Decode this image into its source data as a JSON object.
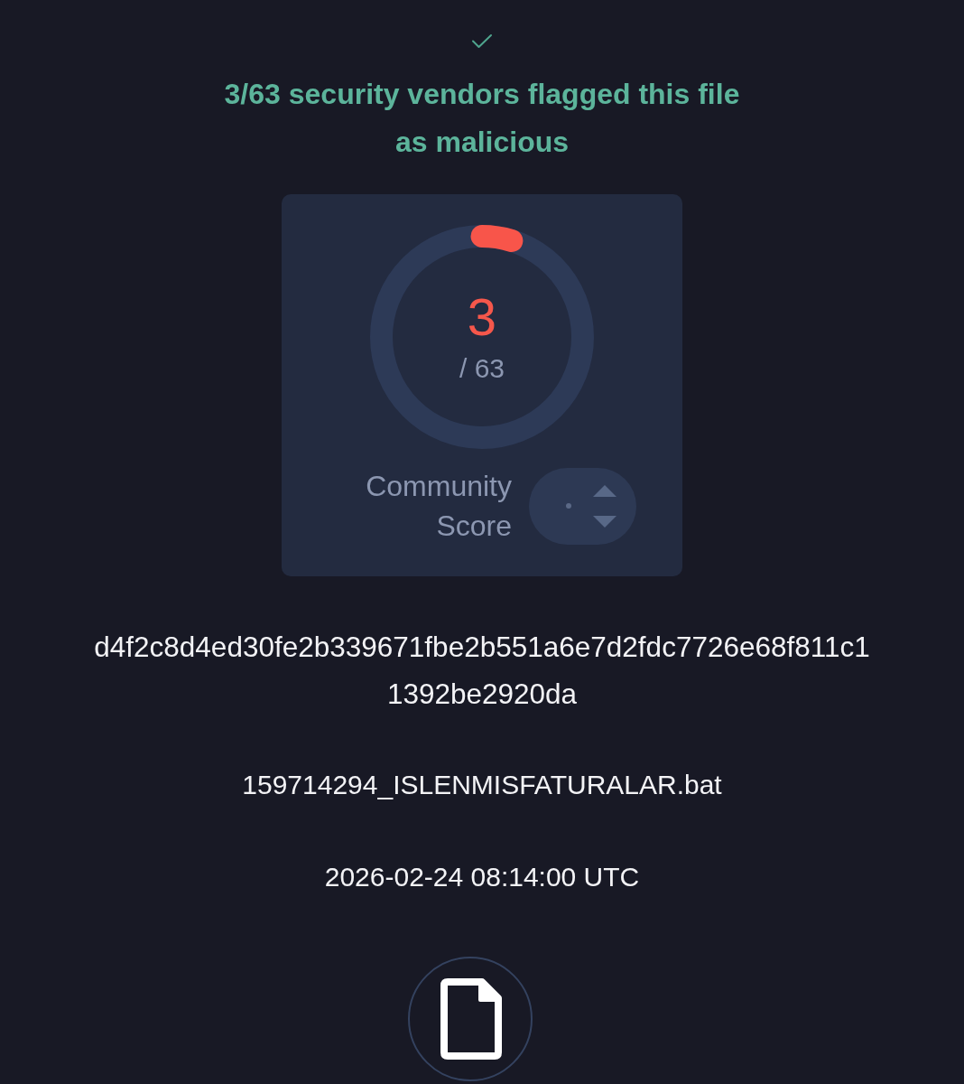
{
  "verdict": {
    "message": "3/63 security vendors flagged this file as malicious"
  },
  "detection_card": {
    "gauge": {
      "detections": "3",
      "total": "/ 63"
    },
    "community_score": {
      "label": "Community Score"
    }
  },
  "file": {
    "hash": "d4f2c8d4ed30fe2b339671fbe2b551a6e7d2fdc7726e68f811c11392be2920da",
    "name": "159714294_ISLENMISFATURALAR.bat",
    "date": "2026-02-24 08:14:00 UTC"
  }
}
